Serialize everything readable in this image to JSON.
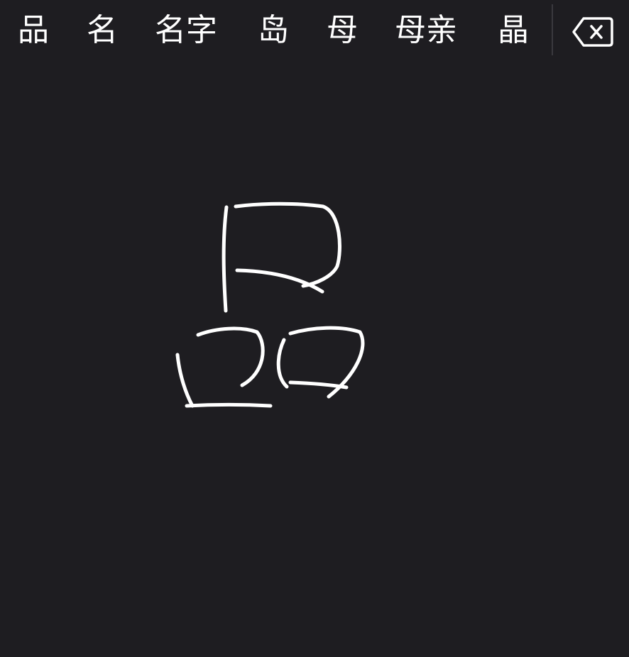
{
  "candidate_bar": {
    "candidates": [
      {
        "label": "品"
      },
      {
        "label": "名"
      },
      {
        "label": "名字"
      },
      {
        "label": "岛"
      },
      {
        "label": "母"
      },
      {
        "label": "母亲"
      },
      {
        "label": "晶"
      }
    ],
    "delete_icon": "backspace-icon"
  },
  "handwriting_canvas": {
    "stroke_color": "#ffffff",
    "background_color": "#1e1d21"
  }
}
